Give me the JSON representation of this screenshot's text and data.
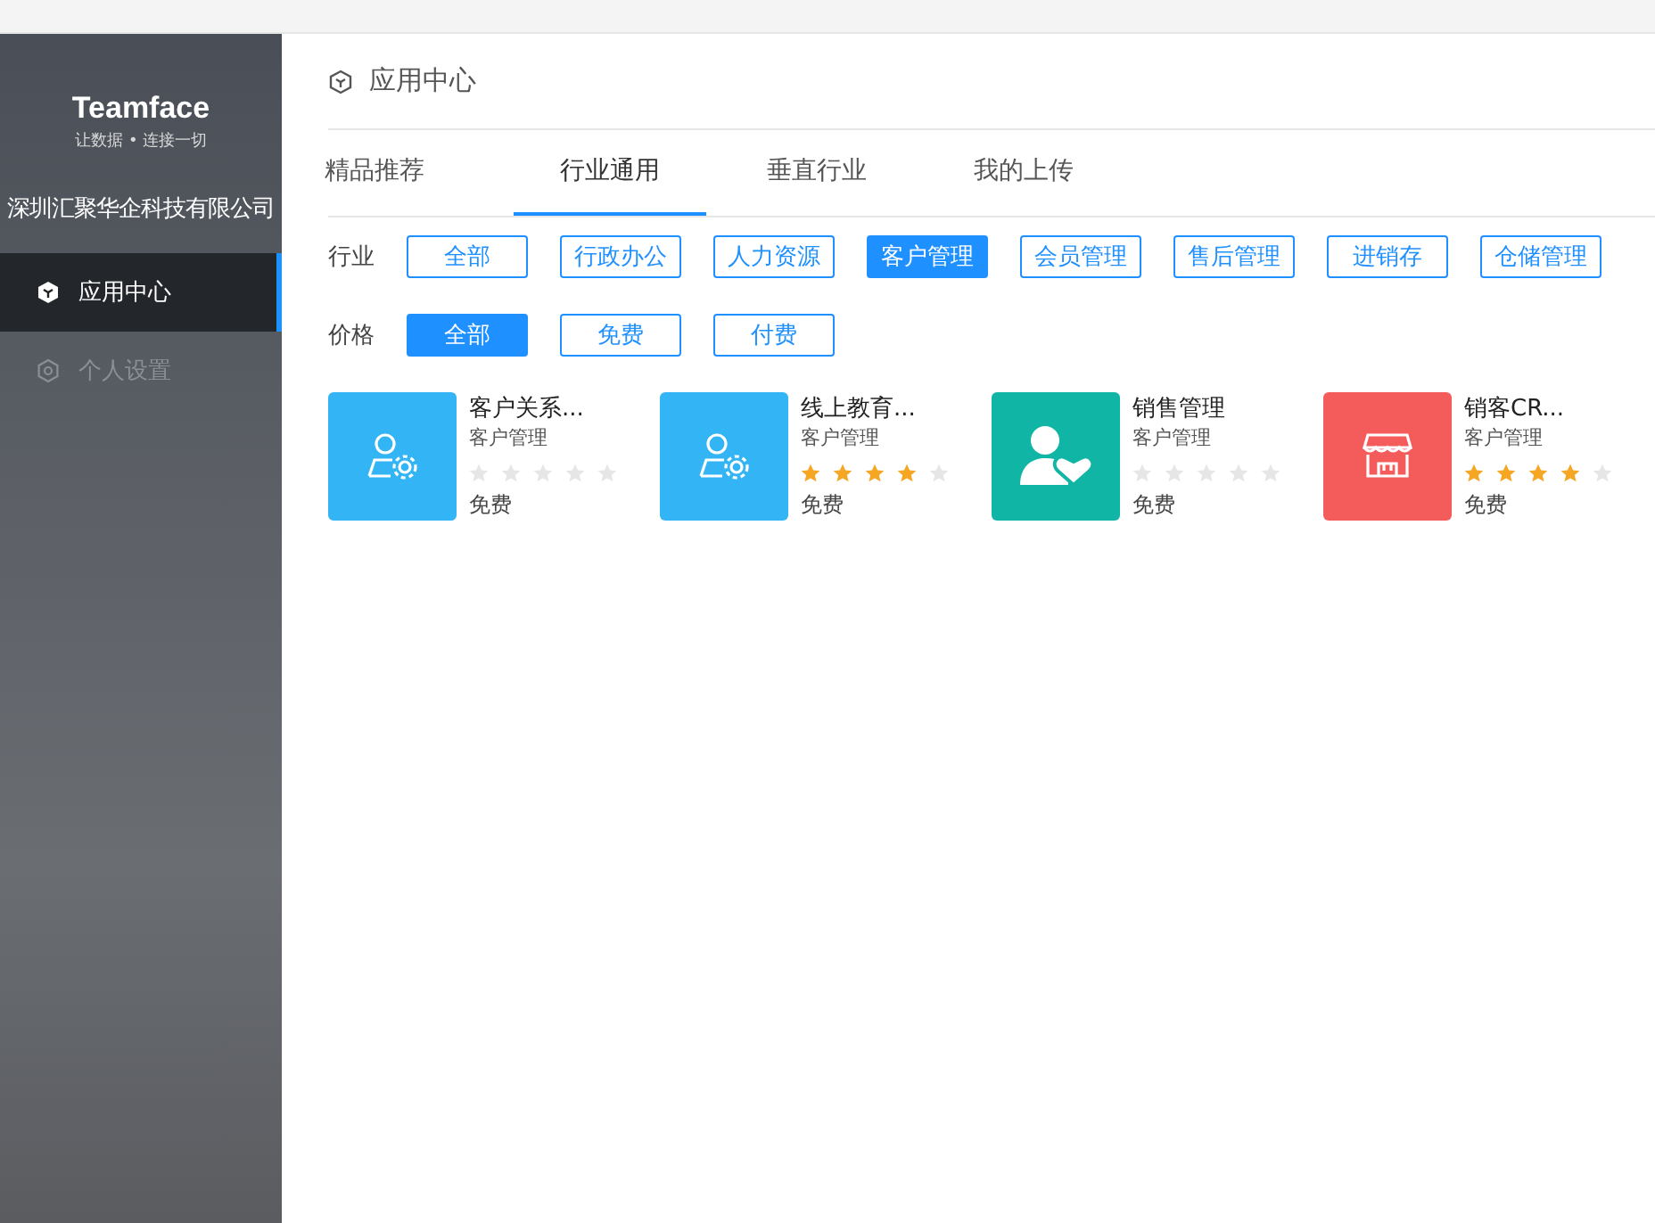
{
  "sidebar": {
    "logo": "Teamface",
    "slogan": "让数据 • 连接一切",
    "company": "深圳汇聚华企科技有限公司",
    "items": [
      {
        "label": "应用中心",
        "selected": true
      },
      {
        "label": "个人设置",
        "selected": false
      }
    ]
  },
  "header": {
    "title": "应用中心"
  },
  "tabs": [
    {
      "label": "精品推荐",
      "selected": false
    },
    {
      "label": "行业通用",
      "selected": true
    },
    {
      "label": "垂直行业",
      "selected": false
    },
    {
      "label": "我的上传",
      "selected": false
    }
  ],
  "filters": [
    {
      "label": "行业",
      "options": [
        {
          "label": "全部",
          "selected": false
        },
        {
          "label": "行政办公",
          "selected": false
        },
        {
          "label": "人力资源",
          "selected": false
        },
        {
          "label": "客户管理",
          "selected": true
        },
        {
          "label": "会员管理",
          "selected": false
        },
        {
          "label": "售后管理",
          "selected": false
        },
        {
          "label": "进销存",
          "selected": false
        },
        {
          "label": "仓储管理",
          "selected": false
        }
      ]
    },
    {
      "label": "价格",
      "options": [
        {
          "label": "全部",
          "selected": true
        },
        {
          "label": "免费",
          "selected": false
        },
        {
          "label": "付费",
          "selected": false
        }
      ]
    }
  ],
  "apps": [
    {
      "name": "客户关系...",
      "category": "客户管理",
      "stars": 0,
      "price": "免费",
      "kind": "user-gear",
      "color": "#33b5f5"
    },
    {
      "name": "线上教育...",
      "category": "客户管理",
      "stars": 4,
      "price": "免费",
      "kind": "user-gear",
      "color": "#33b5f5"
    },
    {
      "name": "销售管理",
      "category": "客户管理",
      "stars": 0,
      "price": "免费",
      "kind": "user-heart",
      "color": "#10b5a5"
    },
    {
      "name": "销客CR...",
      "category": "客户管理",
      "stars": 4,
      "price": "免费",
      "kind": "store",
      "color": "#f45b5b"
    }
  ]
}
